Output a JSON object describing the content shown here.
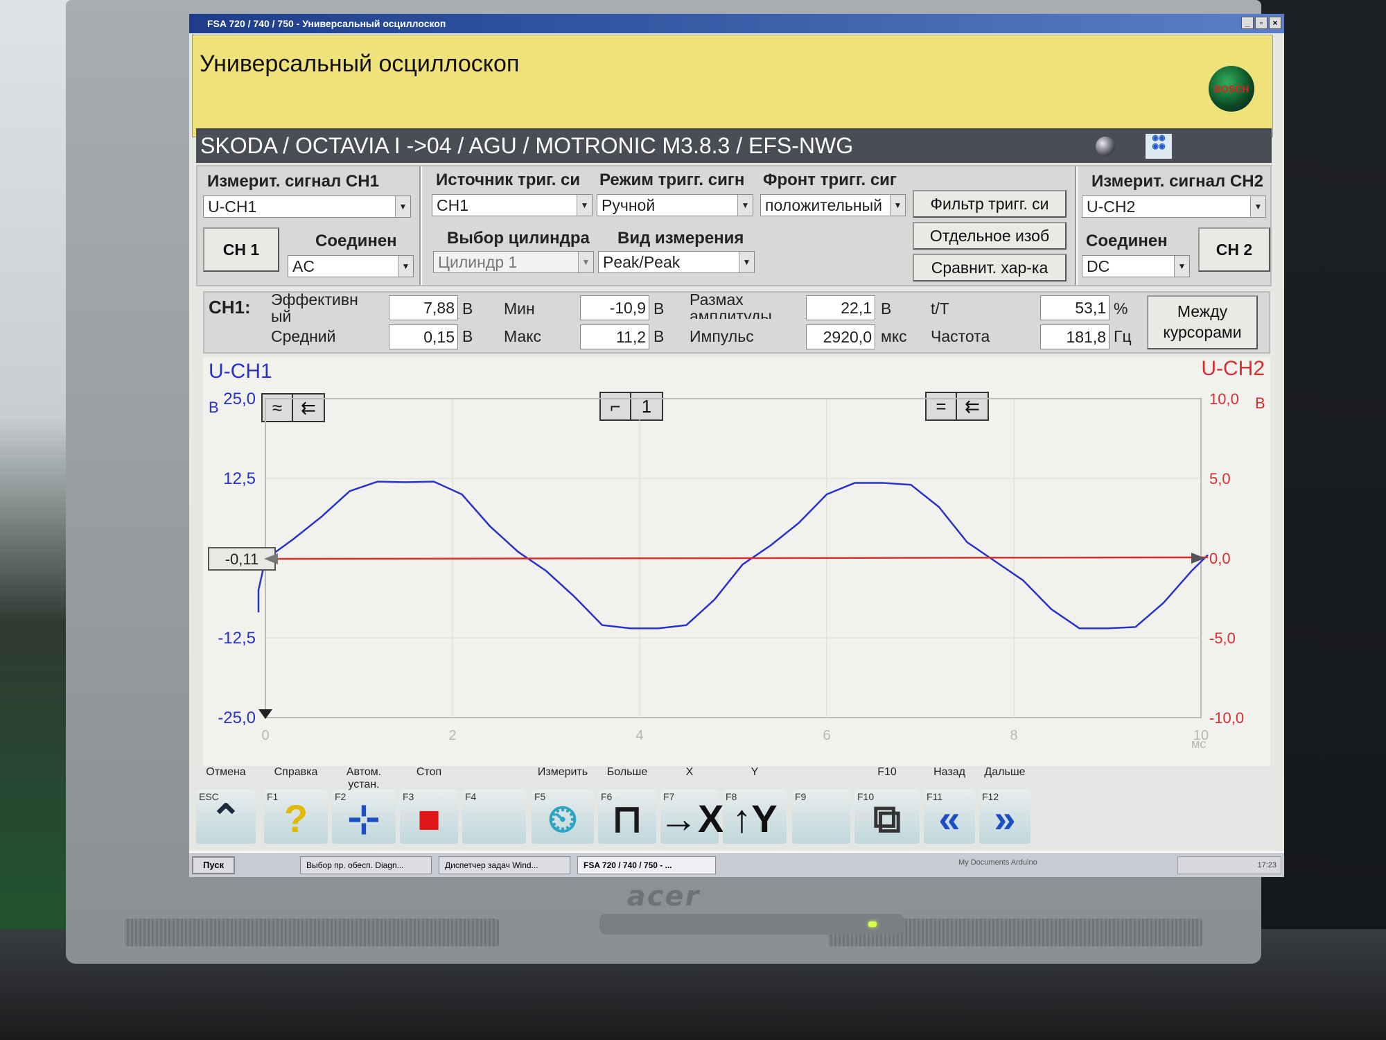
{
  "window": {
    "title": "FSA 720 / 740 / 750 - Универсальный осциллоскоп",
    "buttons": [
      "_",
      "▫",
      "×"
    ]
  },
  "header": {
    "title": "Универсальный осциллоскоп",
    "logo_text": "BOSCH"
  },
  "vehicle": {
    "path": "SKODA / OCTAVIA I ->04 / AGU / MOTRONIC M3.8.3 / EFS-NWG"
  },
  "ch1_settings": {
    "signal_label": "Измерит. сигнал CH1",
    "signal_value": "U-CH1",
    "channel_button": "CH 1",
    "coupling_label": "Соединен",
    "coupling_value": "AC"
  },
  "trigger": {
    "source_label": "Источник триг. си",
    "source_value": "CH1",
    "mode_label": "Режим тригг. сигн",
    "mode_value": "Ручной",
    "edge_label": "Фронт тригг. сиг",
    "edge_value": "положительный",
    "cylinder_label": "Выбор цилиндра",
    "cylinder_value": "Цилиндр 1",
    "measure_label": "Вид измерения",
    "measure_value": "Peak/Peak",
    "filter_button": "Фильтр тригг. си",
    "single_button": "Отдельное изоб",
    "compare_button": "Сравнит. хар-ка"
  },
  "ch2_settings": {
    "signal_label": "Измерит. сигнал CH2",
    "signal_value": "U-CH2",
    "coupling_label": "Соединен",
    "coupling_value": "DC",
    "channel_button": "CH 2"
  },
  "measurements": {
    "channel": "CH1:",
    "rms_label": "Эффективн ый",
    "rms_value": "7,88",
    "rms_unit": "В",
    "avg_label": "Средний",
    "avg_value": "0,15",
    "avg_unit": "В",
    "min_label": "Мин",
    "min_value": "-10,9",
    "min_unit": "В",
    "max_label": "Макс",
    "max_value": "11,2",
    "max_unit": "В",
    "amp_label": "Размах амплитуды",
    "amp_value": "22,1",
    "amp_unit": "В",
    "pulse_label": "Импульс",
    "pulse_value": "2920,0",
    "pulse_unit": "мкс",
    "duty_label": "t/T",
    "duty_value": "53,1",
    "duty_unit": "%",
    "freq_label": "Частота",
    "freq_value": "181,8",
    "freq_unit": "Гц",
    "cursors_button": "Между курсорами"
  },
  "graph": {
    "ch1_title": "U-CH1",
    "ch2_title": "U-CH2",
    "ch1_unit": "В",
    "ch2_unit": "В",
    "ch1_marker": "-0,11",
    "ch1_mode_icons": [
      "≈",
      "⇇"
    ],
    "ch2_mode_icons": [
      "=",
      "⇇"
    ],
    "trigger_icon": "⌐",
    "trigger_channel": "1",
    "colors": {
      "ch1": "#2832c8",
      "ch2": "#d82e2e",
      "grid": "#d9dbd6"
    }
  },
  "chart_data": {
    "type": "line",
    "xlabel": "мс",
    "ylabel": "В",
    "xlim": [
      0,
      10
    ],
    "ylim": [
      -25,
      25
    ],
    "y2lim": [
      -10,
      10
    ],
    "x_ticks": [
      "0",
      "2",
      "4",
      "6",
      "8",
      "10"
    ],
    "y_ticks": [
      "25,0",
      "12,5",
      "-12,5",
      "-25,0"
    ],
    "y2_ticks": [
      "10,0",
      "5,0",
      "0,0",
      "-5,0",
      "-10,0"
    ],
    "grid": true,
    "series": [
      {
        "name": "U-CH1",
        "axis": "left",
        "color": "#2832c8",
        "x": [
          -0.5,
          -0.3,
          0,
          0.3,
          0.6,
          0.9,
          1.2,
          1.5,
          1.8,
          2.1,
          2.4,
          2.7,
          3.0,
          3.3,
          3.6,
          3.9,
          4.2,
          4.5,
          4.8,
          5.1,
          5.4,
          5.7,
          6.0,
          6.3,
          6.6,
          6.9,
          7.2,
          7.5,
          7.8,
          8.1,
          8.4,
          8.7,
          9.0,
          9.3,
          9.6,
          9.9,
          10.1
        ],
        "y": [
          -8.5,
          -5.0,
          -0.2,
          3.0,
          6.5,
          10.5,
          12.0,
          11.9,
          12.0,
          10.0,
          5.0,
          1.0,
          -2.0,
          -6.0,
          -10.5,
          -11.0,
          -11.0,
          -10.5,
          -6.5,
          -1.0,
          2.0,
          5.5,
          10.0,
          11.8,
          11.8,
          11.5,
          8.0,
          2.5,
          -0.5,
          -3.5,
          -8.0,
          -11.0,
          -11.0,
          -10.8,
          -7.0,
          -2.0,
          0.5
        ]
      },
      {
        "name": "U-CH2",
        "axis": "right",
        "color": "#d82e2e",
        "x": [
          -0.5,
          10.1
        ],
        "y": [
          -0.05,
          0.05
        ]
      }
    ]
  },
  "toolbar": {
    "keys": [
      {
        "name": "Отмена",
        "key": "ESC",
        "icon": "⌃"
      },
      {
        "name": "Справка",
        "key": "F1",
        "icon": "?"
      },
      {
        "name": "Автом. устан.",
        "key": "F2",
        "icon": "⊹"
      },
      {
        "name": "Стоп",
        "key": "F3",
        "icon": "■"
      },
      {
        "name": "",
        "key": "F4",
        "icon": ""
      },
      {
        "name": "Измерить",
        "key": "F5",
        "icon": "⏲"
      },
      {
        "name": "Больше",
        "key": "F6",
        "icon": "⊓"
      },
      {
        "name": "X",
        "key": "F7",
        "icon": "→X"
      },
      {
        "name": "Y",
        "key": "F8",
        "icon": "↑Y"
      },
      {
        "name": "",
        "key": "F9",
        "icon": ""
      },
      {
        "name": "F10",
        "key": "F10",
        "icon": "⧉"
      },
      {
        "name": "Назад",
        "key": "F11",
        "icon": "«"
      },
      {
        "name": "Дальше",
        "key": "F12",
        "icon": "»"
      }
    ]
  },
  "taskbar": {
    "start": "Пуск",
    "task1": "Выбор пр. обесп. Diagn...",
    "task2": "Диспетчер задач Wind...",
    "task3": "FSA 720 / 740 / 750 - ...",
    "links": "My Documents   Arduino",
    "clock": "17:23"
  },
  "monitor": {
    "brand": "acer"
  }
}
